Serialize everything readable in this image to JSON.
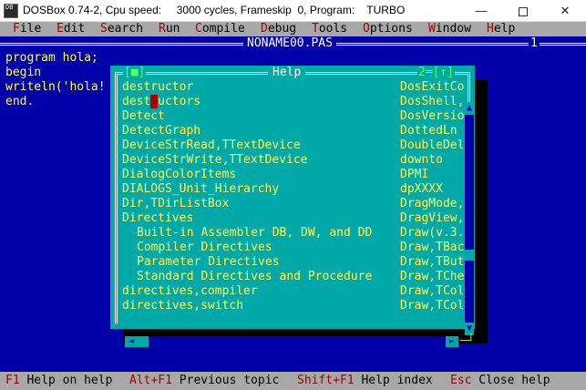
{
  "window": {
    "title": "DOSBox 0.74-2, Cpu speed:     3000 cycles, Frameskip  0, Program:    TURBO",
    "min_glyph": "—",
    "close_glyph": "✕"
  },
  "menu": [
    {
      "hot": "F",
      "rest": "ile"
    },
    {
      "hot": "E",
      "rest": "dit"
    },
    {
      "hot": "S",
      "rest": "earch"
    },
    {
      "hot": "R",
      "rest": "un"
    },
    {
      "hot": "C",
      "rest": "ompile"
    },
    {
      "hot": "D",
      "rest": "ebug"
    },
    {
      "hot": "T",
      "rest": "ools"
    },
    {
      "hot": "O",
      "rest": "ptions"
    },
    {
      "hot": "W",
      "rest": "indow"
    },
    {
      "hot": "H",
      "rest": "elp"
    }
  ],
  "editor": {
    "title": "NONAME00.PAS",
    "window_number": "1",
    "lines": [
      "program hola;",
      "begin",
      "writeln('hola!",
      "end."
    ]
  },
  "help": {
    "title": "Help",
    "close_box": "[■]",
    "zoom_box": "2═[↑]",
    "left_column": [
      {
        "text": "destructor",
        "indent": false
      },
      {
        "text": "destructors",
        "indent": false,
        "cursor_index": 4
      },
      {
        "text": "Detect",
        "indent": false
      },
      {
        "text": "DetectGraph",
        "indent": false
      },
      {
        "text": "DeviceStrRead,TTextDevice",
        "indent": false
      },
      {
        "text": "DeviceStrWrite,TTextDevice",
        "indent": false
      },
      {
        "text": "DialogColorItems",
        "indent": false
      },
      {
        "text": "DIALOGS_Unit_Hierarchy",
        "indent": false
      },
      {
        "text": "Dir,TDirListBox",
        "indent": false
      },
      {
        "text": "Directives",
        "indent": false
      },
      {
        "text": "Built-in Assembler DB, DW, and DD",
        "indent": true
      },
      {
        "text": "Compiler Directives",
        "indent": true
      },
      {
        "text": "Parameter Directives",
        "indent": true
      },
      {
        "text": "Standard Directives and Procedure",
        "indent": true
      },
      {
        "text": "directives,compiler",
        "indent": false
      },
      {
        "text": "directives,switch",
        "indent": false
      }
    ],
    "right_column": [
      "DosExitCo",
      "DosShell,",
      "DosVersio",
      "DottedLn",
      "DoubleDel",
      "downto",
      "DPMI",
      "dpXXXX",
      "DragMode,",
      "DragView,",
      "Draw(v.3.",
      "Draw,TBac",
      "Draw,TBut",
      "Draw,TChe",
      "Draw,TCol",
      "Draw,TCol"
    ]
  },
  "status": [
    {
      "key": "F1",
      "label": " Help on help"
    },
    {
      "key": "Alt+F1",
      "label": " Previous topic"
    },
    {
      "key": "Shift+F1",
      "label": " Help index"
    },
    {
      "key": "Esc",
      "label": " Close help"
    }
  ]
}
